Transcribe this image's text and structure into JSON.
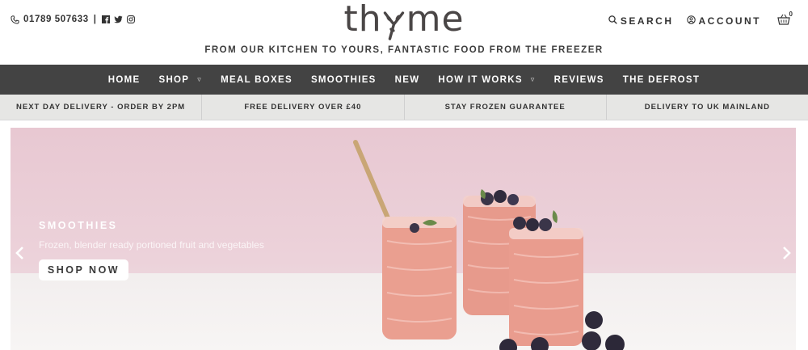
{
  "header": {
    "phone": "01789 507633",
    "separator": "|",
    "logo_text_left": "th",
    "logo_text_right": "me",
    "tagline": "FROM OUR KITCHEN TO YOURS, FANTASTIC FOOD FROM THE FREEZER",
    "search_label": "SEARCH",
    "account_label": "ACCOUNT",
    "basket_count": "0",
    "social_icons": [
      "facebook-icon",
      "twitter-icon",
      "instagram-icon"
    ]
  },
  "nav": {
    "items": [
      {
        "label": "HOME"
      },
      {
        "label": "SHOP",
        "dropdown": true
      },
      {
        "label": "MEAL BOXES"
      },
      {
        "label": "SMOOTHIES"
      },
      {
        "label": "NEW"
      },
      {
        "label": "HOW IT WORKS",
        "dropdown": true
      },
      {
        "label": "REVIEWS"
      },
      {
        "label": "THE DEFROST"
      }
    ],
    "caret_glyph": "▿"
  },
  "usp": [
    "NEXT DAY DELIVERY - ORDER BY 2PM",
    "FREE DELIVERY OVER £40",
    "STAY FROZEN GUARANTEE",
    "DELIVERY TO UK MAINLAND"
  ],
  "hero": {
    "title": "SMOOTHIES",
    "subtitle": "Frozen, blender ready portioned fruit and vegetables",
    "cta_label": "SHOP NOW"
  },
  "colors": {
    "nav_bg": "#434343",
    "usp_bg": "#e6e6e4",
    "hero_pink": "#e8c8d2",
    "smoothie": "#e79a8c"
  }
}
